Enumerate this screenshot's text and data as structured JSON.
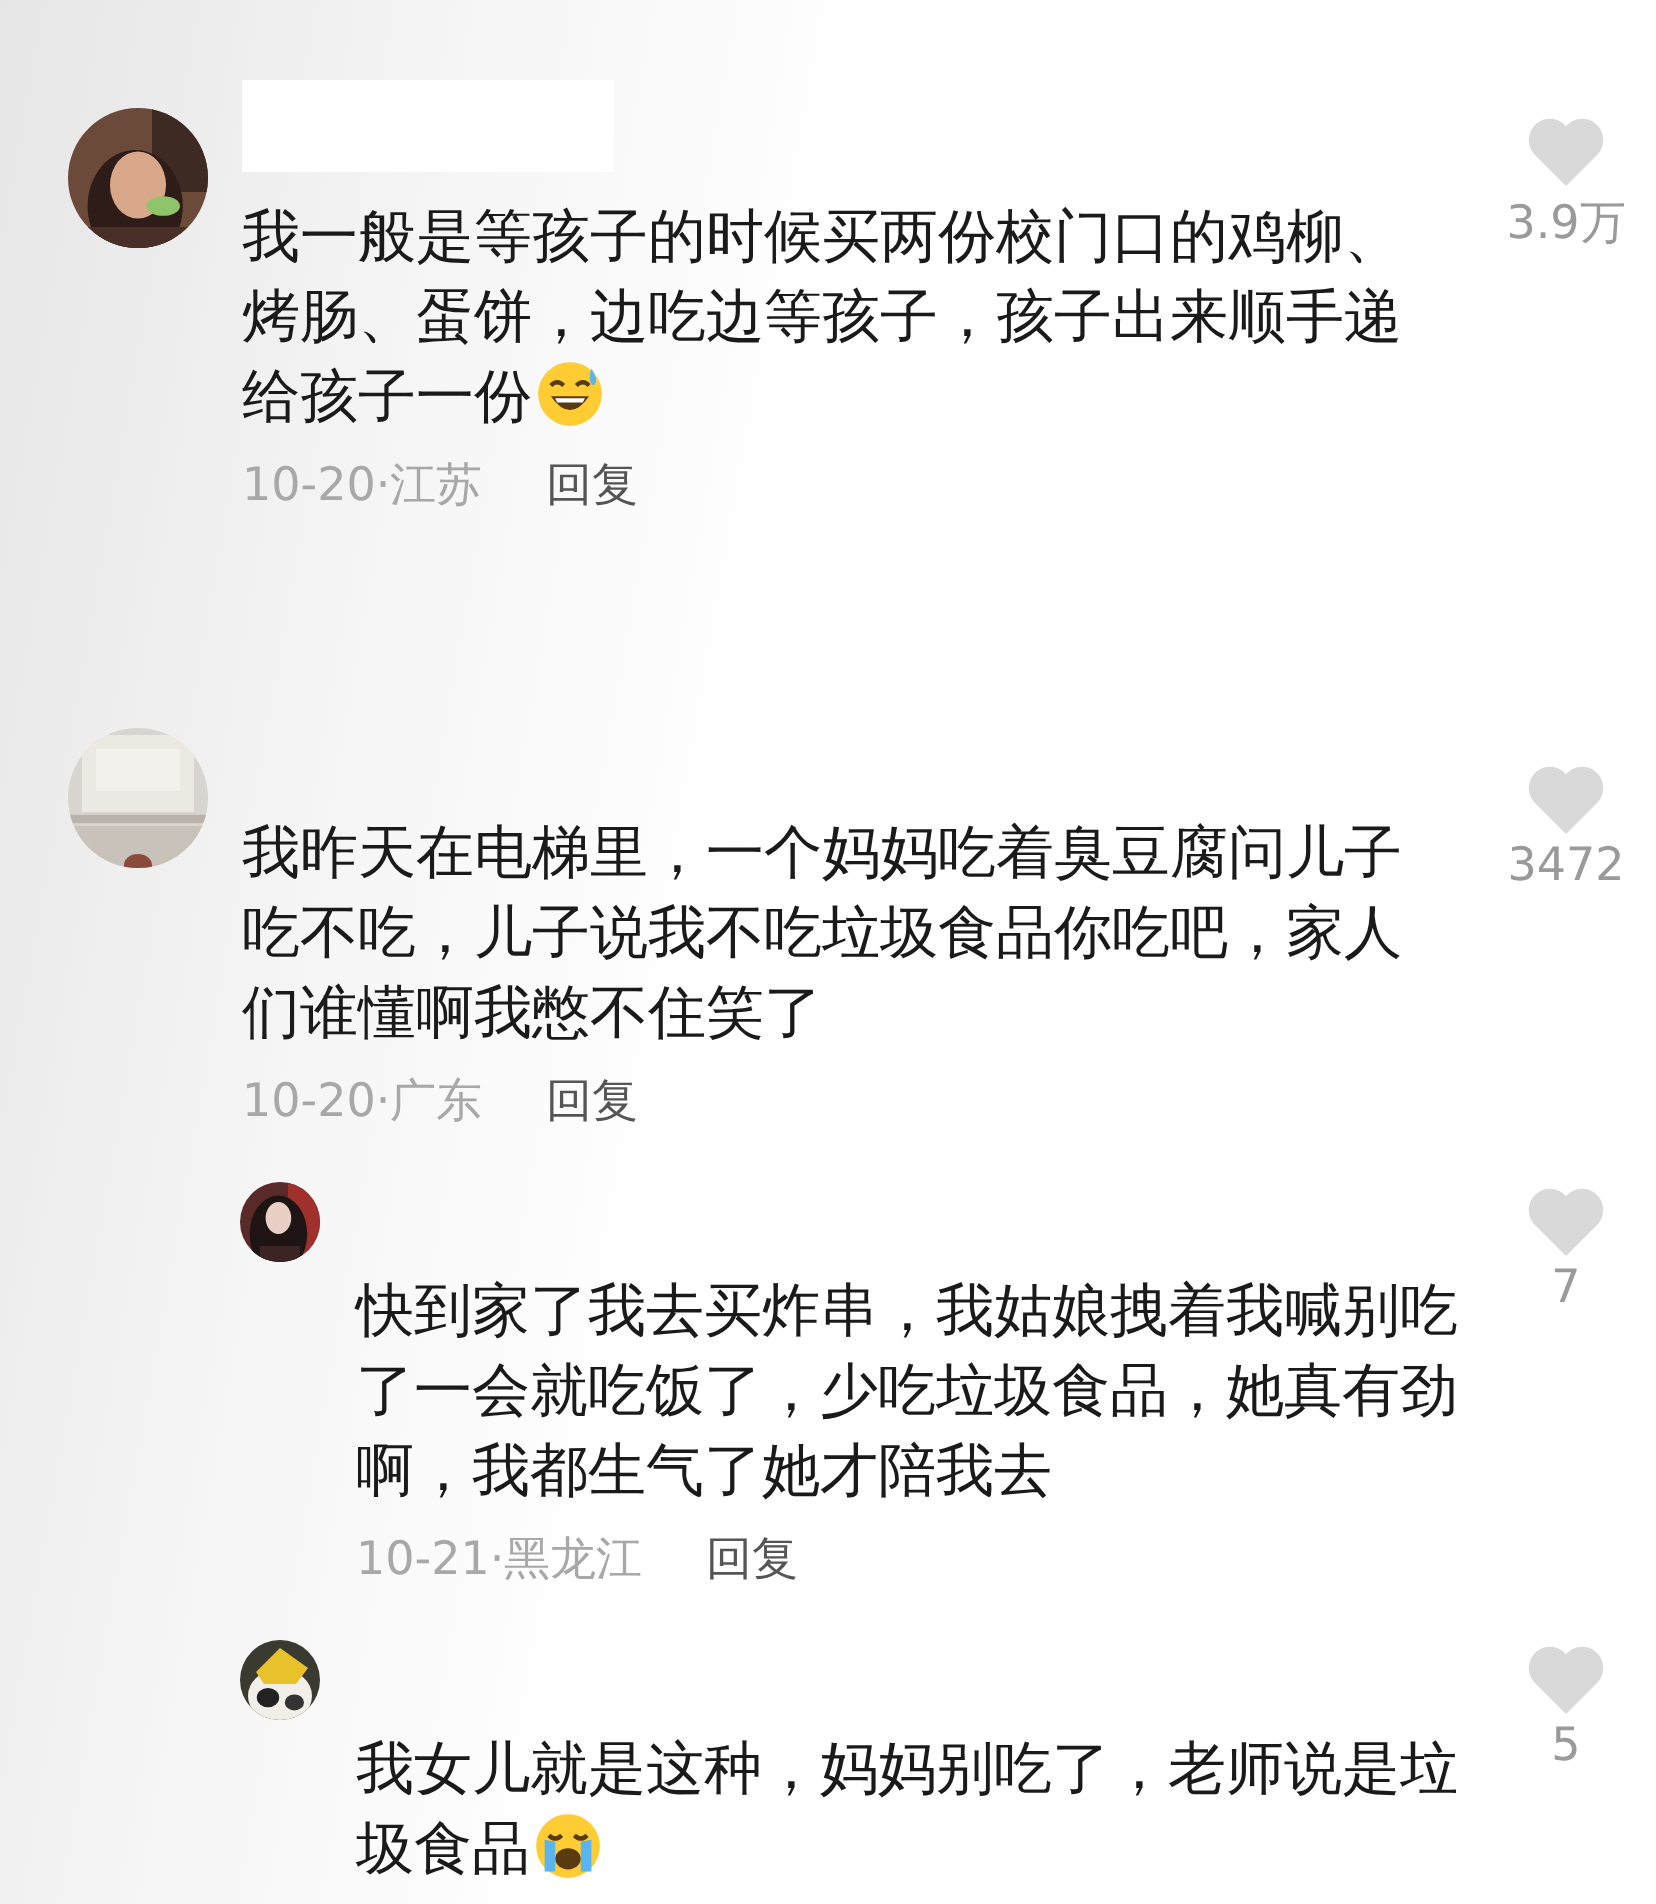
{
  "comments": [
    {
      "text": "我一般是等孩子的时候买两份校门口的鸡柳、烤肠、蛋饼，边吃边等孩子，孩子出来顺手递给孩子一份",
      "emoji": {
        "kind": "sweat-smile"
      },
      "date": "10-20·江苏",
      "reply_label": "回复",
      "likes": "3.9万",
      "liked": false,
      "name_redacted": true
    },
    {
      "text": "我昨天在电梯里，一个妈妈吃着臭豆腐问儿子吃不吃，儿子说我不吃垃圾食品你吃吧，家人们谁懂啊我憋不住笑了",
      "date": "10-20·广东",
      "reply_label": "回复",
      "likes": "3472",
      "liked": false,
      "replies": [
        {
          "text": "快到家了我去买炸串，我姑娘拽着我喊别吃了一会就吃饭了，少吃垃圾食品，她真有劲啊，我都生气了她才陪我去",
          "date": "10-21·黑龙江",
          "reply_label": "回复",
          "likes": "7",
          "liked": false
        },
        {
          "text": "我女儿就是这种，妈妈别吃了，老师说是垃圾食品",
          "emoji": {
            "kind": "crying"
          },
          "likes": "5",
          "liked": false
        }
      ]
    }
  ]
}
